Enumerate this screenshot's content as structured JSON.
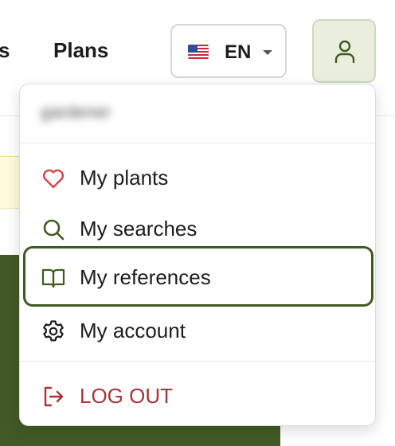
{
  "header": {
    "nav_partial": "s",
    "nav_plans": "Plans",
    "language": {
      "code": "EN",
      "flag_icon": "us-flag-icon"
    },
    "user_icon": "user-icon"
  },
  "menu": {
    "username": "gardener",
    "items": [
      {
        "label": "My plants",
        "icon": "heart-icon",
        "icon_color": "#d9424a"
      },
      {
        "label": "My searches",
        "icon": "search-icon",
        "icon_color": "#3f5a23"
      },
      {
        "label": "My references",
        "icon": "book-icon",
        "icon_color": "#3f5a23",
        "active": true
      },
      {
        "label": "My account",
        "icon": "gear-icon",
        "icon_color": "#1c1c1c"
      }
    ],
    "logout": {
      "label": "LOG OUT",
      "icon": "logout-icon",
      "color": "#a8343a"
    }
  },
  "colors": {
    "accent": "#3f5a23",
    "accent_bg": "#e9efdc",
    "page_green": "#435a26",
    "notice_bg": "#fffbdc"
  }
}
